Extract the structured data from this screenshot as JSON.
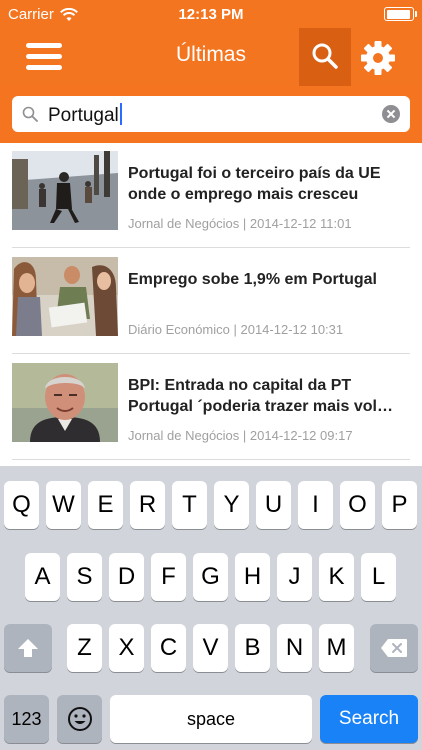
{
  "status_bar": {
    "carrier": "Carrier",
    "time": "12:13 PM",
    "battery_level": 0.95
  },
  "nav": {
    "title": "Últimas",
    "menu_icon": "hamburger-icon",
    "search_icon": "search-icon",
    "settings_icon": "gear-icon"
  },
  "search": {
    "value": "Portugal"
  },
  "articles": [
    {
      "title": "Portugal foi o terceiro país da UE onde o emprego mais cresceu",
      "source": "Jornal de Negócios",
      "date": "2014-12-12 11:01"
    },
    {
      "title": "Emprego sobe 1,9% em Portugal",
      "source": "Diário Económico",
      "date": "2014-12-12 10:31"
    },
    {
      "title": "BPI: Entrada no capital da PT Portugal ´poderia trazer mais vol…",
      "source": "Jornal de Negócios",
      "date": "2014-12-12 09:17"
    }
  ],
  "keyboard": {
    "row1": [
      "Q",
      "W",
      "E",
      "R",
      "T",
      "Y",
      "U",
      "I",
      "O",
      "P"
    ],
    "row2": [
      "A",
      "S",
      "D",
      "F",
      "G",
      "H",
      "J",
      "K",
      "L"
    ],
    "row3": [
      "Z",
      "X",
      "C",
      "V",
      "B",
      "N",
      "M"
    ],
    "numbers_label": "123",
    "space_label": "space",
    "search_label": "Search",
    "shift_icon": "shift-arrow-icon",
    "delete_icon": "backspace-icon",
    "emoji_icon": "emoji-icon"
  },
  "colors": {
    "header": "#f4751f",
    "search_active": "#d95f12",
    "keyboard_bg": "#d1d5db",
    "search_key": "#1a82f7"
  }
}
